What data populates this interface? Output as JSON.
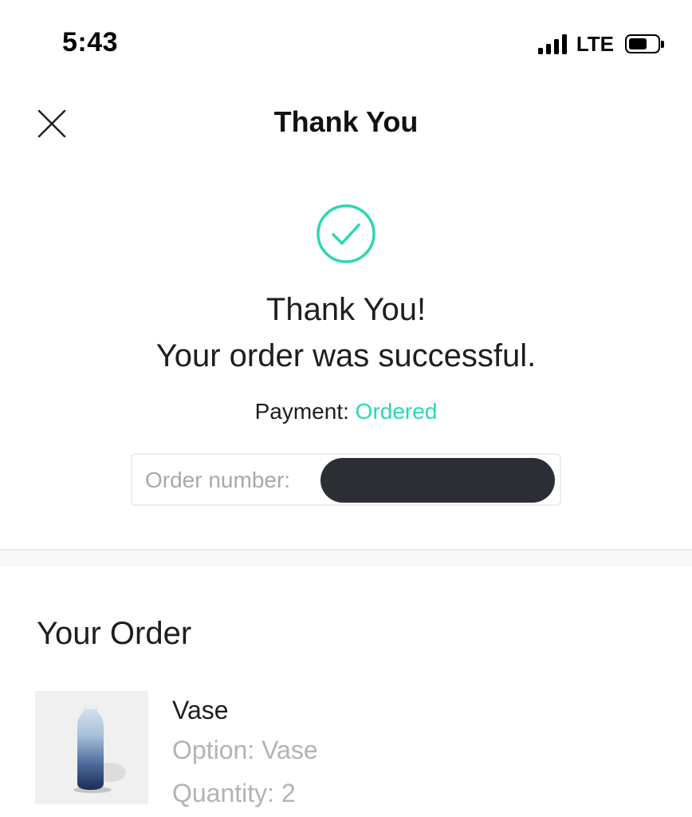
{
  "status_bar": {
    "time": "5:43",
    "network": "LTE",
    "signal_icon": "cellular-signal-icon",
    "battery_icon": "battery-icon"
  },
  "nav": {
    "title": "Thank You",
    "close_icon": "close-icon"
  },
  "confirmation": {
    "icon": "check-circle-icon",
    "heading": "Thank You!",
    "message": "Your order was successful.",
    "payment_label": "Payment:",
    "payment_status": "Ordered",
    "order_number_label": "Order number:"
  },
  "order": {
    "section_title": "Your Order",
    "items": [
      {
        "name": "Vase",
        "option": "Option: Vase",
        "quantity": "Quantity: 2",
        "image_icon": "vase-image"
      }
    ]
  },
  "colors": {
    "accent": "#2ad8b4",
    "muted_text": "#b2b3b8",
    "redaction": "#2b2f33"
  }
}
